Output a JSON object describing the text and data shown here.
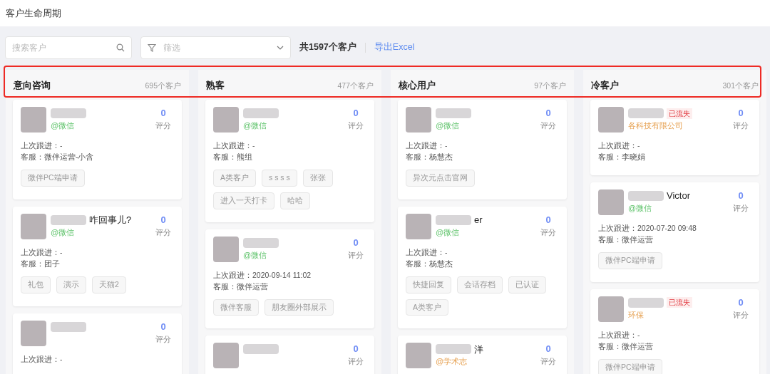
{
  "page_title": "客户生命周期",
  "toolbar": {
    "search_placeholder": "搜索客户",
    "filter_placeholder": "筛选",
    "total": "共1597个客户",
    "export_link": "导出Excel"
  },
  "columns": [
    {
      "title": "意向咨询",
      "count": "695个客户",
      "cards": [
        {
          "source": {
            "text": "@微信",
            "kind": "wechat"
          },
          "score": "0",
          "score_label": "评分",
          "last_follow": "上次跟进：-",
          "service": "客服：微伴运营-小含",
          "tags": [
            "微伴PC端申请"
          ]
        },
        {
          "name": "咋回事儿?",
          "source": {
            "text": "@微信",
            "kind": "wechat"
          },
          "score": "0",
          "score_label": "评分",
          "last_follow": "上次跟进：-",
          "service": "客服：团子",
          "tags": [
            "礼包",
            "演示",
            "天猫2"
          ]
        },
        {
          "score": "0",
          "score_label": "评分",
          "last_follow": "上次跟进：-"
        }
      ]
    },
    {
      "title": "熟客",
      "count": "477个客户",
      "cards": [
        {
          "source": {
            "text": "@微信",
            "kind": "wechat"
          },
          "score": "0",
          "score_label": "评分",
          "last_follow": "上次跟进：-",
          "service": "客服：熊组",
          "tags": [
            "A类客户",
            "s s s s",
            "张张",
            "进入一天打卡",
            "哈哈"
          ]
        },
        {
          "source": {
            "text": "@微信",
            "kind": "wechat"
          },
          "score": "0",
          "score_label": "评分",
          "last_follow": "上次跟进：2020-09-14 11:02",
          "service": "客服：微伴运营",
          "tags": [
            "微伴客服",
            "朋友圈外部展示"
          ]
        },
        {
          "score": "0",
          "score_label": "评分"
        }
      ]
    },
    {
      "title": "核心用户",
      "count": "97个客户",
      "cards": [
        {
          "source": {
            "text": "@微信",
            "kind": "wechat"
          },
          "score": "0",
          "score_label": "评分",
          "last_follow": "上次跟进：-",
          "service": "客服：杨慧杰",
          "tags": [
            "异次元点击官网"
          ]
        },
        {
          "name": "er",
          "source": {
            "text": "@微信",
            "kind": "wechat"
          },
          "score": "0",
          "score_label": "评分",
          "last_follow": "上次跟进：-",
          "service": "客服：杨慧杰",
          "tags": [
            "快捷回复",
            "会话存档",
            "已认证",
            "A类客户"
          ]
        },
        {
          "name": "洋",
          "source": {
            "text": "@学术志",
            "kind": "company"
          },
          "score": "0",
          "score_label": "评分"
        }
      ]
    },
    {
      "title": "冷客户",
      "count": "301个客户",
      "cards": [
        {
          "badge": "已流失",
          "source": {
            "text": "各科技有限公司",
            "kind": "company"
          },
          "score": "0",
          "score_label": "评分",
          "last_follow": "上次跟进：-",
          "service": "客服：李晓娟"
        },
        {
          "name": "Victor",
          "source": {
            "text": "@微信",
            "kind": "wechat"
          },
          "score": "0",
          "score_label": "评分",
          "last_follow": "上次跟进：2020-07-20 09:48",
          "service": "客服：微伴运营",
          "tags": [
            "微伴PC端申请"
          ]
        },
        {
          "badge": "已流失",
          "source": {
            "text": "环保",
            "kind": "company"
          },
          "score": "0",
          "score_label": "评分",
          "last_follow": "上次跟进：-",
          "service": "客服：微伴运营",
          "tags": [
            "微伴PC端申请"
          ]
        }
      ]
    }
  ]
}
